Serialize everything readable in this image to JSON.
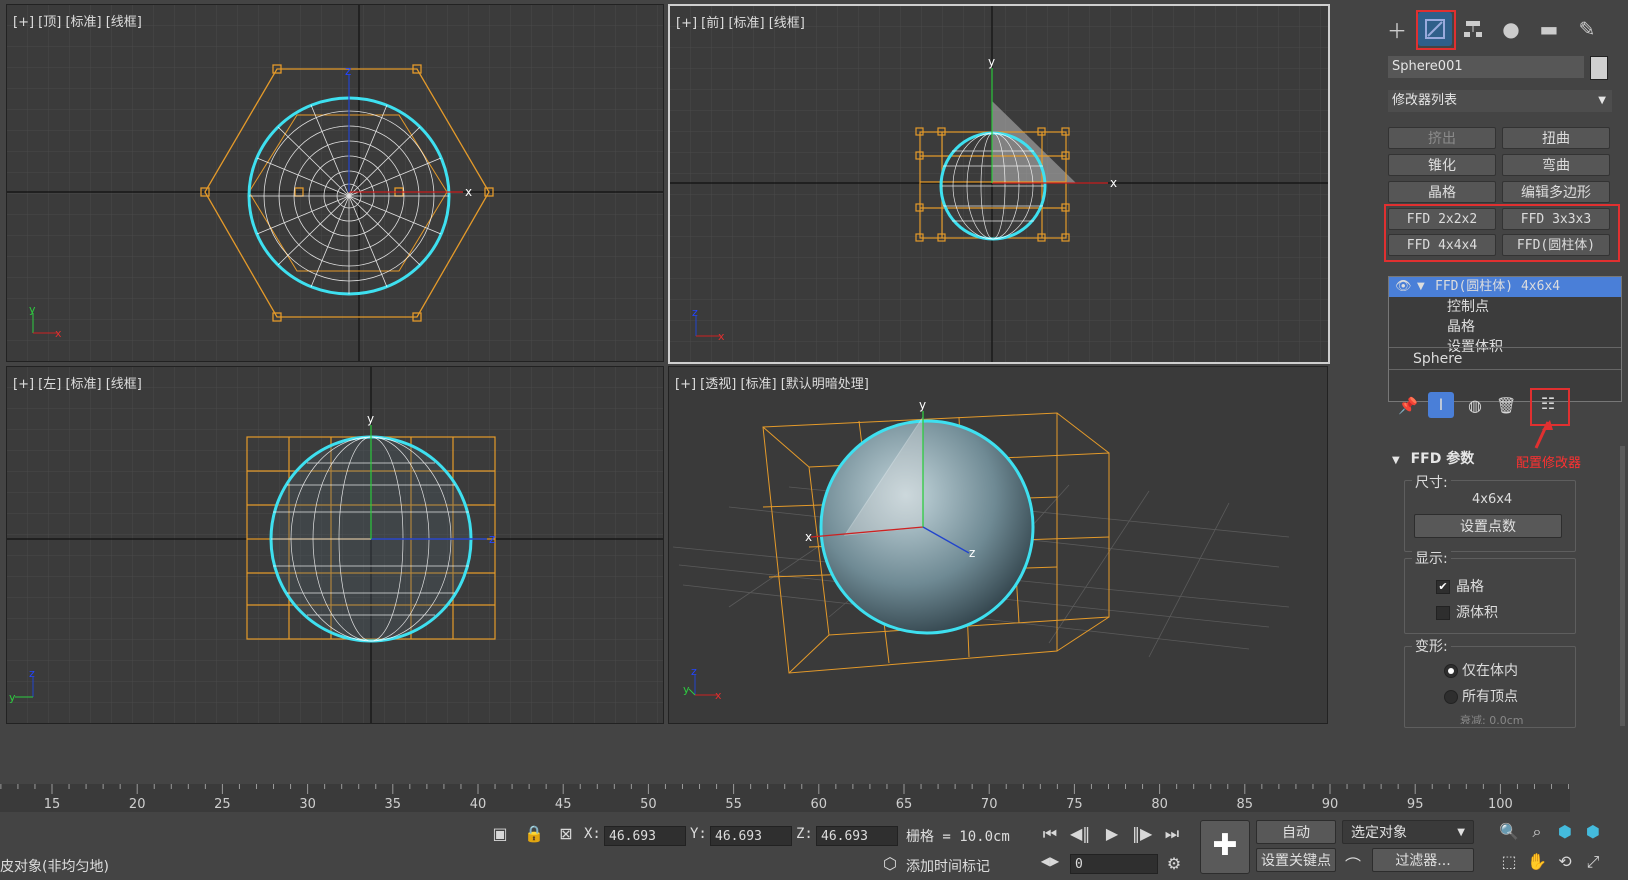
{
  "viewports": {
    "top": {
      "label": "[+] [顶] [标准] [线框]"
    },
    "front": {
      "label": "[+] [前] [标准] [线框]"
    },
    "left": {
      "label": "[+] [左] [标准] [线框]"
    },
    "persp": {
      "label": "[+] [透视] [标准] [默认明暗处理]"
    }
  },
  "axes": {
    "x": "x",
    "y": "y",
    "z": "z"
  },
  "panel": {
    "tabs": [
      "create-icon",
      "modify-icon",
      "hierarchy-icon",
      "motion-icon",
      "display-icon",
      "utilities-icon"
    ],
    "object_name": "Sphere001",
    "modifier_list": "修改器列表",
    "modifier_buttons": [
      "挤出",
      "扭曲",
      "锥化",
      "弯曲",
      "晶格",
      "编辑多边形"
    ],
    "ffd_buttons": [
      "FFD 2x2x2",
      "FFD 3x3x3",
      "FFD 4x4x4",
      "FFD(圆柱体)"
    ],
    "stack": {
      "top": "FFD(圆柱体) 4x6x4",
      "children": [
        "控制点",
        "晶格",
        "设置体积"
      ],
      "base": "Sphere"
    },
    "annotation": "配置修改器",
    "rollout_title": "FFD 参数",
    "size_label": "尺寸:",
    "size_value": "4x6x4",
    "set_points": "设置点数",
    "display_label": "显示:",
    "display_lattice": "晶格",
    "display_source": "源体积",
    "deform_label": "变形:",
    "deform_inside": "仅在体内",
    "deform_all": "所有顶点",
    "falloff_label": "衰减: 0.0cm"
  },
  "timeline": {
    "ticks": [
      "15",
      "20",
      "25",
      "30",
      "35",
      "40",
      "45",
      "50",
      "55",
      "60",
      "65",
      "70",
      "75",
      "80",
      "85",
      "90",
      "95",
      "100"
    ]
  },
  "status": {
    "left_text": "皮对象(非均匀地)",
    "x_label": "X:",
    "x": "46.693",
    "y_label": "Y:",
    "y": "46.693",
    "z_label": "Z:",
    "z": "46.693",
    "grid": "栅格 = 10.0cm",
    "add_time_tag": "添加时间标记",
    "auto": "自动",
    "selected": "选定对象",
    "set_key": "设置关键点",
    "filters": "过滤器...",
    "frame": "0"
  },
  "colors": {
    "accent_red": "#e03030",
    "sphere_cyan": "#3ee0f0",
    "lattice_orange": "#e49a2a",
    "selection_blue": "#4a7fd8"
  }
}
